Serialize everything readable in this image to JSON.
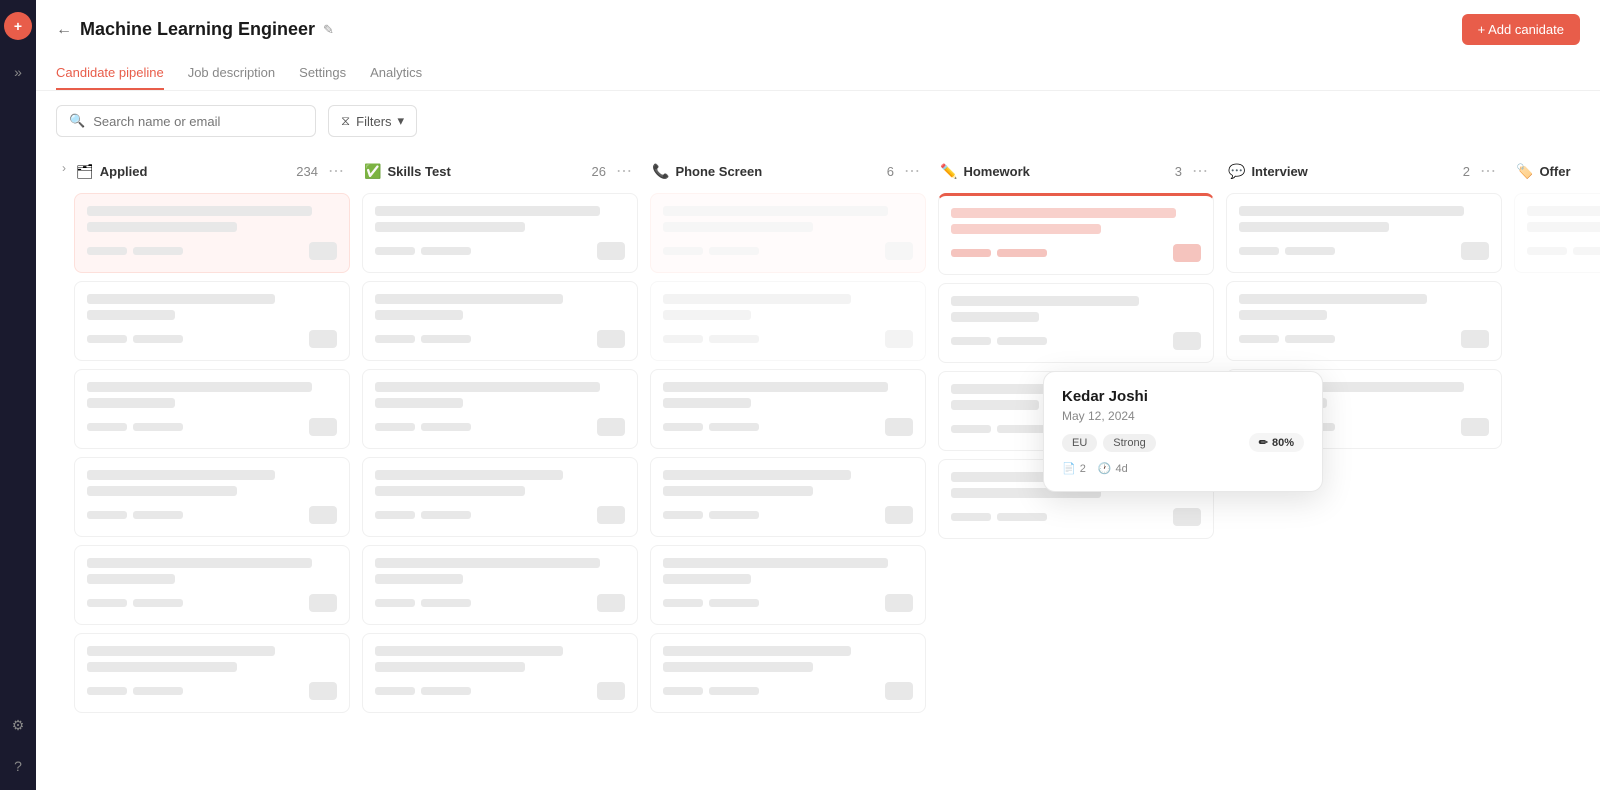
{
  "sidebar": {
    "logo": "+",
    "icons": [
      "»",
      "⚙",
      "?"
    ]
  },
  "header": {
    "title": "Machine Learning Engineer",
    "add_button": "+ Add canidate",
    "tabs": [
      {
        "label": "Candidate pipeline",
        "active": true
      },
      {
        "label": "Job description",
        "active": false
      },
      {
        "label": "Settings",
        "active": false
      },
      {
        "label": "Analytics",
        "active": false
      }
    ]
  },
  "toolbar": {
    "search_placeholder": "Search name or email",
    "filter_label": "Filters"
  },
  "columns": [
    {
      "id": "applied",
      "icon": "📋",
      "title": "Applied",
      "count": 234
    },
    {
      "id": "skills-test",
      "icon": "✅",
      "title": "Skills Test",
      "count": 26
    },
    {
      "id": "phone-screen",
      "icon": "📞",
      "title": "Phone Screen",
      "count": 6
    },
    {
      "id": "homework",
      "icon": "✏️",
      "title": "Homework",
      "count": 3
    },
    {
      "id": "interview",
      "icon": "💬",
      "title": "Interview",
      "count": 2
    },
    {
      "id": "offer",
      "icon": "🏷️",
      "title": "Offer",
      "count": ""
    }
  ],
  "popup": {
    "name": "Kedar Joshi",
    "date": "May 12, 2024",
    "score": "80%",
    "score_icon": "✏",
    "tags": [
      "EU",
      "Strong"
    ],
    "meta": [
      {
        "icon": "📄",
        "value": "2"
      },
      {
        "icon": "🕐",
        "value": "4d"
      }
    ]
  }
}
